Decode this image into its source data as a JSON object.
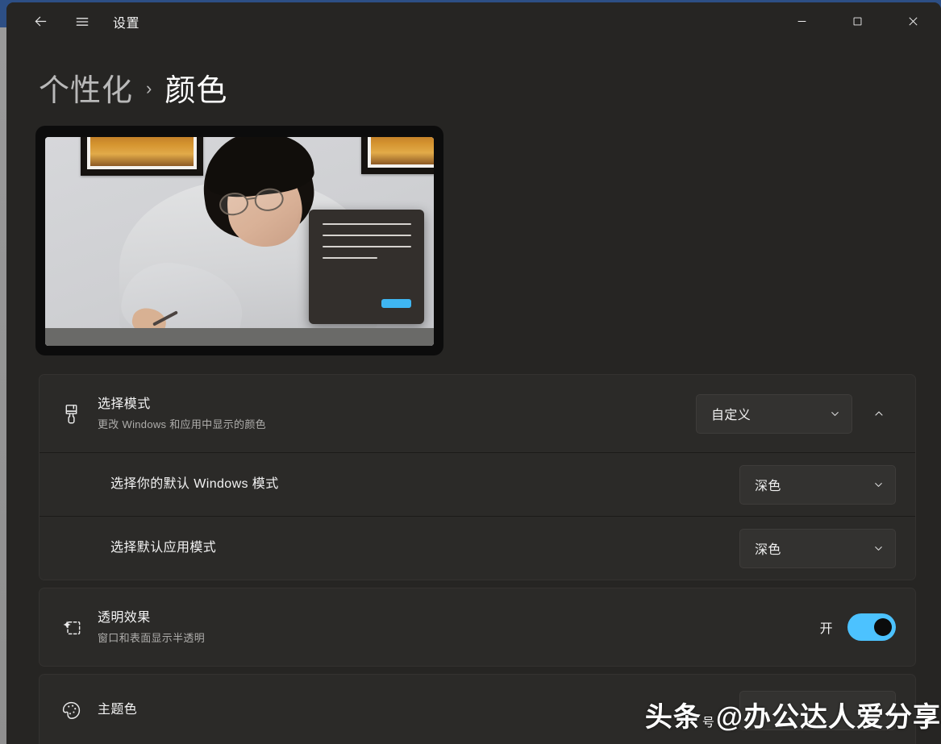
{
  "window": {
    "title": "设置",
    "back_tooltip": "返回",
    "menu_tooltip": "导航菜单",
    "minimize": "—",
    "maximize": "□",
    "close": "✕"
  },
  "breadcrumb": {
    "parent": "个性化",
    "separator": "›",
    "current": "颜色"
  },
  "preview": {
    "name": "颜色预览",
    "accent_color": "#3fb6f2"
  },
  "settings": {
    "mode": {
      "icon": "paintbrush-icon",
      "title": "选择模式",
      "description": "更改 Windows 和应用中显示的颜色",
      "value": "自定义",
      "expander_state": "展开"
    },
    "windows_mode": {
      "title": "选择你的默认 Windows 模式",
      "value": "深色"
    },
    "app_mode": {
      "title": "选择默认应用模式",
      "value": "深色"
    },
    "transparency": {
      "icon": "sparkle-icon",
      "title": "透明效果",
      "description": "窗口和表面显示半透明",
      "state_label": "开",
      "toggle_on": true,
      "accent": "#4cc2ff"
    },
    "accent_color": {
      "icon": "palette-icon",
      "title": "主题色",
      "value": ""
    }
  },
  "watermark": {
    "brand": "头条",
    "small": "号",
    "handle": "@办公达人爱分享"
  }
}
